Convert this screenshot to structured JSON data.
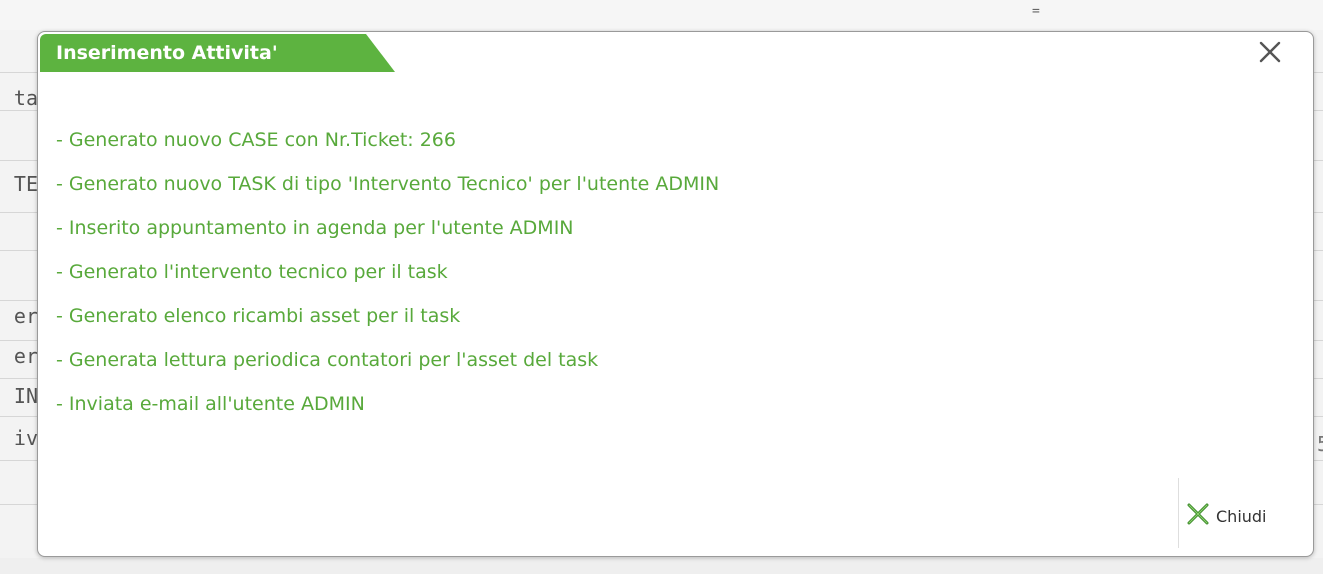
{
  "background": {
    "handle_glyph": "=",
    "row_fragments": [
      "ta",
      "TE",
      "er",
      "er",
      "IN",
      "iv"
    ],
    "right_fragment": "5"
  },
  "dialog": {
    "title": "Inserimento Attivita'",
    "messages": [
      "- Generato nuovo CASE con  Nr.Ticket: 266",
      "- Generato nuovo TASK di tipo 'Intervento Tecnico' per l'utente ADMIN",
      "- Inserito appuntamento in agenda per l'utente ADMIN",
      "- Generato l'intervento tecnico per il task",
      "- Generato elenco ricambi asset per il task",
      "- Generata lettura periodica contatori per l'asset del task",
      "- Inviata e-mail all'utente ADMIN"
    ],
    "close_label": "Chiudi"
  },
  "colors": {
    "accent_green": "#5db340",
    "message_text": "#58a93b",
    "close_icon_green": "#3c8a2a"
  },
  "icons": {
    "title_close": "close-icon",
    "button_close": "close-icon"
  }
}
